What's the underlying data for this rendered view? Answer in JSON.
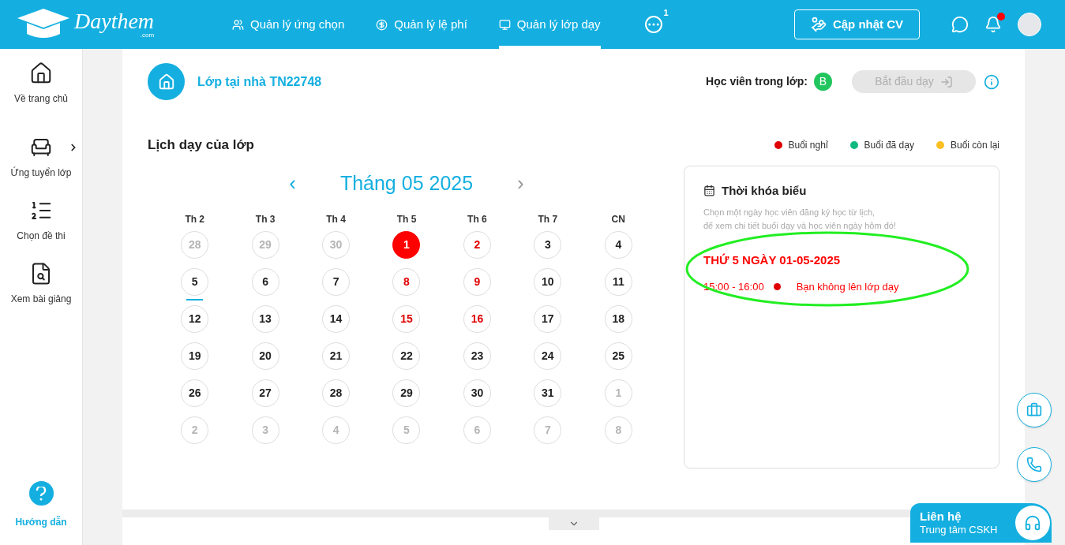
{
  "logo": {
    "name": "Daythem",
    "suffix": ".com"
  },
  "nav": [
    {
      "label": "Quản lý ứng chọn",
      "selected": false
    },
    {
      "label": "Quản lý lệ phí",
      "selected": false
    },
    {
      "label": "Quản lý lớp dạy",
      "selected": true
    }
  ],
  "more_badge": "1",
  "cv_button": "Cập nhật CV",
  "notification_dot": true,
  "sidebar": [
    {
      "label": "Về trang chủ",
      "has_submenu": false
    },
    {
      "label": "Ứng tuyển lớp",
      "has_submenu": true
    },
    {
      "label": "Chọn đề thi",
      "has_submenu": false
    },
    {
      "label": "Xem bài giảng",
      "has_submenu": false
    }
  ],
  "help": "Hướng dẫn",
  "class_title": "Lớp tại nhà TN22748",
  "students_label": "Học viên trong lớp:",
  "students": [
    {
      "initial": "B",
      "color": "#22c55e"
    }
  ],
  "start_button": {
    "label": "Bắt đầu dạy",
    "disabled": true
  },
  "schedule_title": "Lịch dạy của lớp",
  "legend": [
    {
      "label": "Buổi nghỉ",
      "color": "#e00000"
    },
    {
      "label": "Buổi đã dạy",
      "color": "#10b981"
    },
    {
      "label": "Buổi còn lại",
      "color": "#fbbf24"
    }
  ],
  "calendar": {
    "prev": "‹",
    "month": "Tháng 05 2025",
    "next": "›",
    "weekdays": [
      "Th 2",
      "Th 3",
      "Th 4",
      "Th 5",
      "Th 6",
      "Th 7",
      "CN"
    ],
    "days": [
      {
        "label": "28",
        "kind": "other",
        "selected": false,
        "today": false
      },
      {
        "label": "29",
        "kind": "other",
        "selected": false,
        "today": false
      },
      {
        "label": "30",
        "kind": "other",
        "selected": false,
        "today": false
      },
      {
        "label": "1",
        "kind": "absent",
        "selected": true,
        "today": false
      },
      {
        "label": "2",
        "kind": "absent",
        "selected": false,
        "today": false
      },
      {
        "label": "3",
        "kind": "normal",
        "selected": false,
        "today": false
      },
      {
        "label": "4",
        "kind": "normal",
        "selected": false,
        "today": false
      },
      {
        "label": "5",
        "kind": "normal",
        "selected": false,
        "today": true
      },
      {
        "label": "6",
        "kind": "normal",
        "selected": false,
        "today": false
      },
      {
        "label": "7",
        "kind": "normal",
        "selected": false,
        "today": false
      },
      {
        "label": "8",
        "kind": "absent",
        "selected": false,
        "today": false
      },
      {
        "label": "9",
        "kind": "absent",
        "selected": false,
        "today": false
      },
      {
        "label": "10",
        "kind": "normal",
        "selected": false,
        "today": false
      },
      {
        "label": "11",
        "kind": "normal",
        "selected": false,
        "today": false
      },
      {
        "label": "12",
        "kind": "normal",
        "selected": false,
        "today": false
      },
      {
        "label": "13",
        "kind": "normal",
        "selected": false,
        "today": false
      },
      {
        "label": "14",
        "kind": "normal",
        "selected": false,
        "today": false
      },
      {
        "label": "15",
        "kind": "absent",
        "selected": false,
        "today": false
      },
      {
        "label": "16",
        "kind": "absent",
        "selected": false,
        "today": false
      },
      {
        "label": "17",
        "kind": "normal",
        "selected": false,
        "today": false
      },
      {
        "label": "18",
        "kind": "normal",
        "selected": false,
        "today": false
      },
      {
        "label": "19",
        "kind": "normal",
        "selected": false,
        "today": false
      },
      {
        "label": "20",
        "kind": "normal",
        "selected": false,
        "today": false
      },
      {
        "label": "21",
        "kind": "normal",
        "selected": false,
        "today": false
      },
      {
        "label": "22",
        "kind": "normal",
        "selected": false,
        "today": false
      },
      {
        "label": "23",
        "kind": "normal",
        "selected": false,
        "today": false
      },
      {
        "label": "24",
        "kind": "normal",
        "selected": false,
        "today": false
      },
      {
        "label": "25",
        "kind": "normal",
        "selected": false,
        "today": false
      },
      {
        "label": "26",
        "kind": "normal",
        "selected": false,
        "today": false
      },
      {
        "label": "27",
        "kind": "normal",
        "selected": false,
        "today": false
      },
      {
        "label": "28",
        "kind": "normal",
        "selected": false,
        "today": false
      },
      {
        "label": "29",
        "kind": "normal",
        "selected": false,
        "today": false
      },
      {
        "label": "30",
        "kind": "normal",
        "selected": false,
        "today": false
      },
      {
        "label": "31",
        "kind": "normal",
        "selected": false,
        "today": false
      },
      {
        "label": "1",
        "kind": "other",
        "selected": false,
        "today": false
      },
      {
        "label": "2",
        "kind": "other",
        "selected": false,
        "today": false
      },
      {
        "label": "3",
        "kind": "other",
        "selected": false,
        "today": false
      },
      {
        "label": "4",
        "kind": "other",
        "selected": false,
        "today": false
      },
      {
        "label": "5",
        "kind": "other",
        "selected": false,
        "today": false
      },
      {
        "label": "6",
        "kind": "other",
        "selected": false,
        "today": false
      },
      {
        "label": "7",
        "kind": "other",
        "selected": false,
        "today": false
      },
      {
        "label": "8",
        "kind": "other",
        "selected": false,
        "today": false
      }
    ]
  },
  "timetable": {
    "title": "Thời khóa biểu",
    "hint": [
      "Chọn một ngày học viên đăng ký học từ lịch,",
      "để xem chi tiết buổi dạy và học viên ngày hôm đó!"
    ],
    "date": "THỨ 5 NGÀY 01-05-2025",
    "sessions": [
      {
        "time": "15:00 - 16:00",
        "color": "#e00000",
        "note": "Bạn không lên lớp dạy"
      }
    ]
  },
  "contact": {
    "title": "Liên hệ",
    "subtitle": "Trung tâm CSKH"
  }
}
